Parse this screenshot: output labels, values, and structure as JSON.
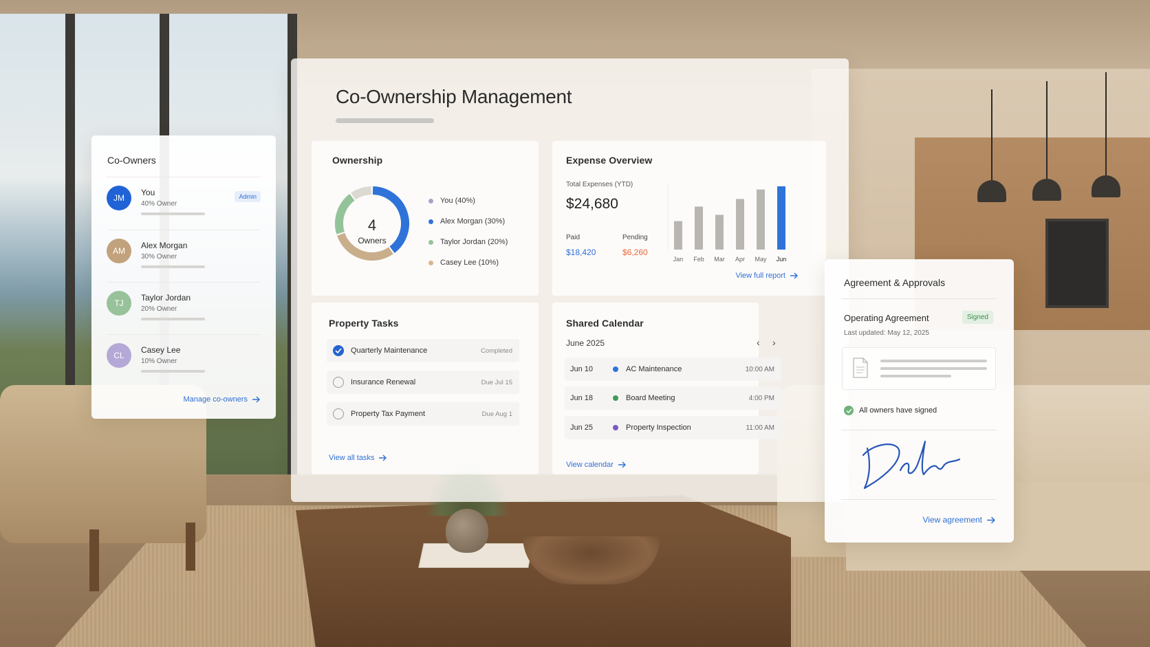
{
  "main": {
    "title": "Co-Ownership Management"
  },
  "ownership": {
    "title": "Ownership",
    "center_number": "4",
    "center_label": "Owners",
    "legend": [
      {
        "label": "You (40%)",
        "share": 40,
        "color": "#2f73d9"
      },
      {
        "label": "Alex Morgan (30%)",
        "share": 30,
        "color": "#c9ae8b"
      },
      {
        "label": "Taylor Jordan (20%)",
        "share": 20,
        "color": "#94c39a"
      },
      {
        "label": "Casey Lee (10%)",
        "share": 10,
        "color": "#dcd8d2"
      }
    ],
    "legend_dot_colors": [
      "#a7a3c9",
      "#2f73d9",
      "#94c39a",
      "#d9b58e"
    ]
  },
  "expense": {
    "title": "Expense Overview",
    "subtitle": "Total Expenses (YTD)",
    "total": "$24,680",
    "paid_label": "Paid",
    "paid_value": "$18,420",
    "pending_label": "Pending",
    "pending_value": "$6,260",
    "view_link": "View full report",
    "chart": {
      "type": "bar",
      "categories": [
        "Jan",
        "Feb",
        "Mar",
        "Apr",
        "May",
        "Jun"
      ],
      "values": [
        45,
        68,
        55,
        80,
        95,
        100
      ],
      "highlight_index": 5,
      "bar_color": "#b9b6b2",
      "highlight_color": "#2f73d9"
    }
  },
  "tasks": {
    "title": "Property Tasks",
    "items": [
      {
        "name": "Quarterly Maintenance",
        "status": "Completed",
        "done": true
      },
      {
        "name": "Insurance Renewal",
        "status": "Due Jul 15",
        "done": false
      },
      {
        "name": "Property Tax Payment",
        "status": "Due Aug 1",
        "done": false
      }
    ],
    "view_link": "View all tasks"
  },
  "calendar": {
    "title": "Shared Calendar",
    "month": "June 2025",
    "prev_icon": "‹",
    "next_icon": "›",
    "events": [
      {
        "date": "Jun 10",
        "name": "AC Maintenance",
        "time": "10:00 AM",
        "color": "#2f73d9"
      },
      {
        "date": "Jun 18",
        "name": "Board Meeting",
        "time": "4:00 PM",
        "color": "#3e9a5a"
      },
      {
        "date": "Jun 25",
        "name": "Property Inspection",
        "time": "11:00 AM",
        "color": "#7a5bc4"
      }
    ],
    "view_link": "View calendar"
  },
  "co_owners": {
    "title": "Co-Owners",
    "owners": [
      {
        "initials": "JM",
        "name": "You",
        "share": "40% Owner",
        "color": "#1f63d6",
        "badge": "Admin"
      },
      {
        "initials": "AM",
        "name": "Alex Morgan",
        "share": "30% Owner",
        "color": "#c2a27c",
        "badge": ""
      },
      {
        "initials": "TJ",
        "name": "Taylor Jordan",
        "share": "20% Owner",
        "color": "#98c29a",
        "badge": ""
      },
      {
        "initials": "CL",
        "name": "Casey Lee",
        "share": "10% Owner",
        "color": "#b4a9d6",
        "badge": ""
      }
    ],
    "manage_link": "Manage co-owners"
  },
  "agreement": {
    "title": "Agreement & Approvals",
    "doc_title": "Operating Agreement",
    "badge": "Signed",
    "updated": "Last updated: May 12, 2025",
    "all_signed": "All owners have signed",
    "view_link": "View agreement"
  }
}
